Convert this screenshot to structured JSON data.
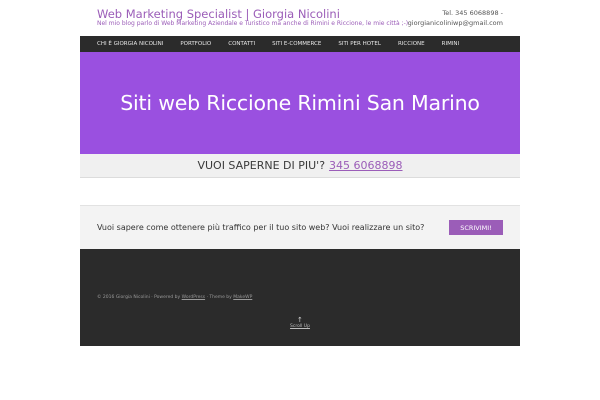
{
  "header": {
    "title": "Web Marketing Specialist | Giorgia Nicolini",
    "tagline": "Nel mio blog parlo di Web Marketing Aziendale e Turistico ma anche di Rimini e Riccione, le mie città ;-)",
    "phone": "Tel. 345 6068898 -",
    "email": "giorgianicoliniwp@gmail.com"
  },
  "nav": {
    "items": [
      {
        "label": "CHI È GIORGIA NICOLINI"
      },
      {
        "label": "PORTFOLIO"
      },
      {
        "label": "CONTATTI"
      },
      {
        "label": "SITI E-COMMERCE"
      },
      {
        "label": "SITI PER HOTEL"
      },
      {
        "label": "RICCIONE"
      },
      {
        "label": "RIMINI"
      }
    ]
  },
  "banner": {
    "heading": "Siti web Riccione Rimini San Marino"
  },
  "callbar": {
    "text": "VUOI SAPERNE DI PIU'?",
    "phone": "345 6068898"
  },
  "cta": {
    "text": "Vuoi sapere come ottenere più traffico per il tuo sito web? Vuoi realizzare un sito?",
    "button": "SCRIVIMI!"
  },
  "footer": {
    "copyright": "© 2016 Giorgia Nicolini · Powered by",
    "wordpress": "WordPress",
    "theme_text": " · Theme by",
    "theme_link": "MakeWP",
    "scroll_arrow": "↑",
    "scroll_label": "Scroll Up"
  },
  "colors": {
    "accent": "#9b5db8",
    "banner": "#9a50e0",
    "dark": "#2b2b2b"
  }
}
